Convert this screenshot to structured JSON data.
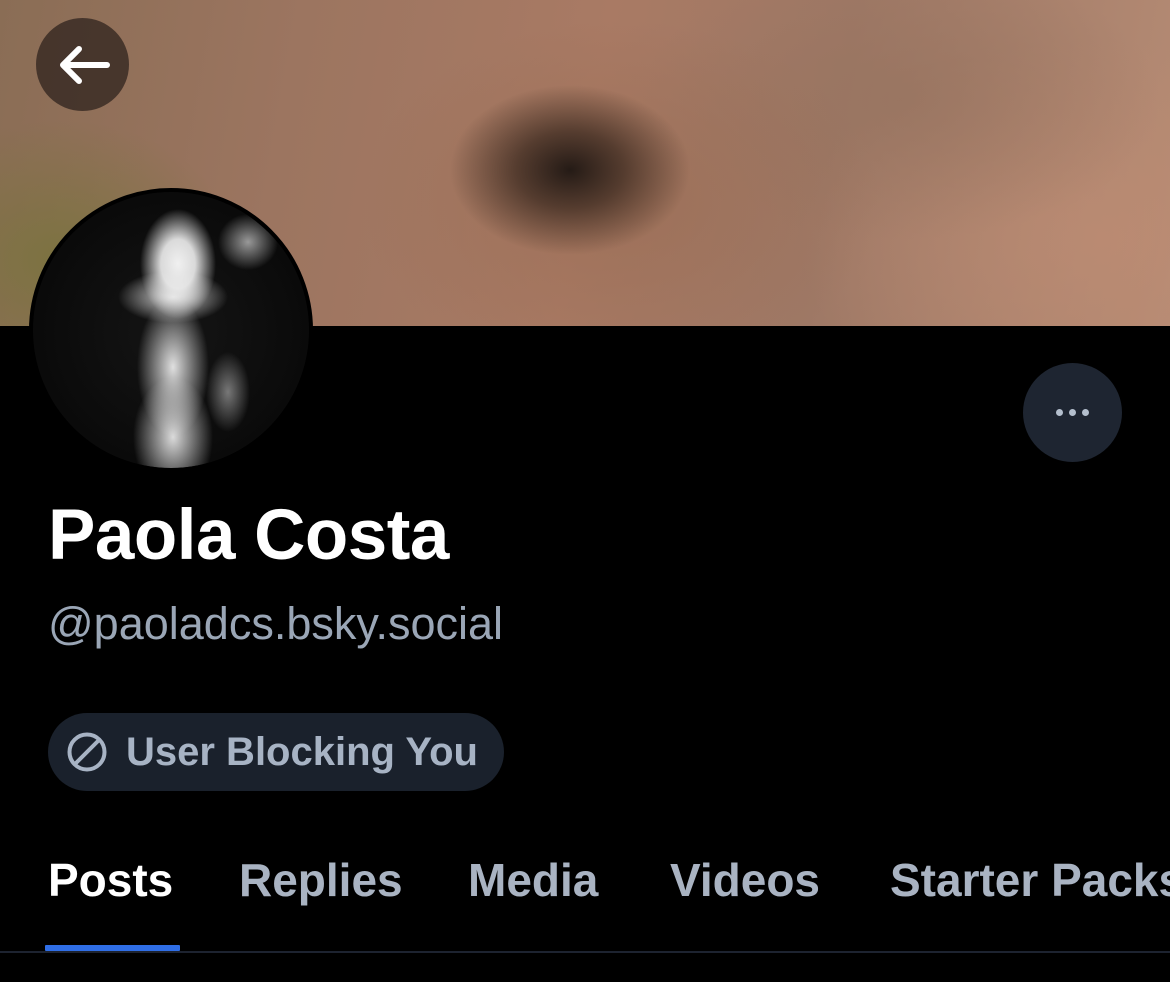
{
  "header": {
    "back_icon": "arrow-left-icon"
  },
  "profile": {
    "display_name": "Paola Costa",
    "handle": "@paoladcs.bsky.social",
    "more_icon": "ellipsis-icon"
  },
  "status_badge": {
    "icon": "block-icon",
    "label": "User Blocking You"
  },
  "tabs": [
    {
      "label": "Posts",
      "active": true
    },
    {
      "label": "Replies",
      "active": false
    },
    {
      "label": "Media",
      "active": false
    },
    {
      "label": "Videos",
      "active": false
    },
    {
      "label": "Starter Packs",
      "active": false
    }
  ],
  "colors": {
    "background": "#000000",
    "accent": "#2f6ee6",
    "muted_text": "#9aa6b6",
    "badge_bg": "#1a212c"
  }
}
